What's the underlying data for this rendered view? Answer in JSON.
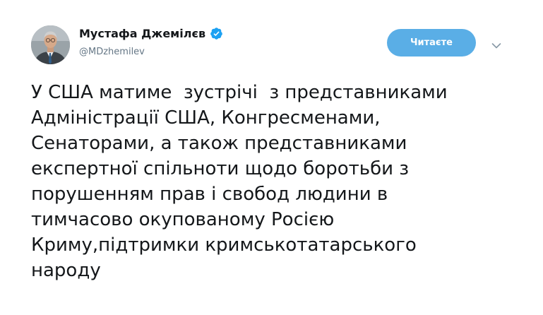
{
  "author": {
    "name": "Мустафа Джемілєв",
    "handle": "@MDzhemilev",
    "verified": true
  },
  "actions": {
    "follow_label": "Читаєте"
  },
  "icons": {
    "verified": "verified-badge-icon",
    "caret": "chevron-down-icon",
    "avatar": "avatar"
  },
  "colors": {
    "follow_button": "#5aaee6",
    "verified_badge": "#1da1f2",
    "handle": "#657786",
    "text": "#14171a"
  },
  "tweet": {
    "text": "У США матиме  зустрічі  з представниками\nАдміністрації США, Конгресменами,\nСенаторами, а також представниками\nекспертної спільноти щодо боротьби з\nпорушенням прав і свобод людини в\nтимчасово окупованому Росією\nКриму,підтримки кримськотатарського\nнароду"
  }
}
